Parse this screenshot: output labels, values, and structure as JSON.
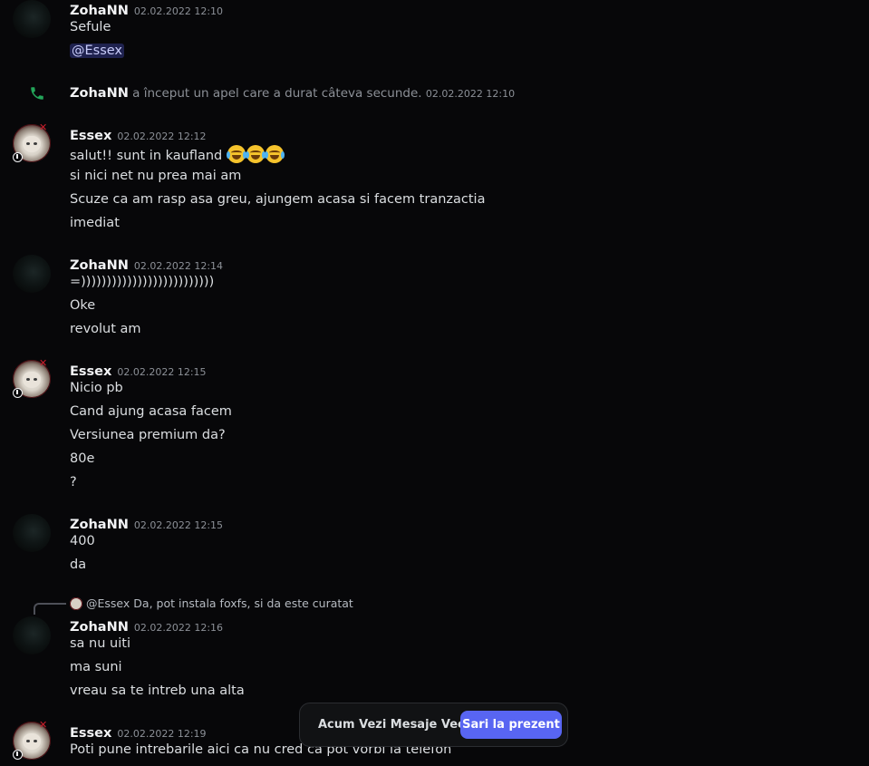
{
  "messages": {
    "g1": {
      "author": "ZohaNN",
      "time": "02.02.2022 12:10",
      "lines": [
        "Sefule",
        "@Essex"
      ]
    },
    "call": {
      "author": "ZohaNN",
      "text": "a început un apel care a durat câteva secunde.",
      "time": "02.02.2022 12:10"
    },
    "g2": {
      "author": "Essex",
      "time": "02.02.2022 12:12",
      "lines": [
        "salut!! sunt in kaufland",
        "si nici net nu prea mai am",
        "Scuze ca am rasp asa greu, ajungem acasa si facem tranzactia",
        "imediat"
      ]
    },
    "g3": {
      "author": "ZohaNN",
      "time": "02.02.2022 12:14",
      "lines": [
        "=))))))))))))))))))))))))))",
        "Oke",
        "revolut am"
      ]
    },
    "g4": {
      "author": "Essex",
      "time": "02.02.2022 12:15",
      "lines": [
        "Nicio pb",
        "Cand ajung acasa facem",
        "Versiunea premium da?",
        "80e",
        "?"
      ]
    },
    "g5": {
      "author": "ZohaNN",
      "time": "02.02.2022 12:15",
      "lines": [
        "400",
        "da"
      ]
    },
    "reply": {
      "author": "@Essex",
      "text": "Da, pot instala foxfs, si da este curatat"
    },
    "g6": {
      "author": "ZohaNN",
      "time": "02.02.2022 12:16",
      "lines": [
        "sa nu uiti",
        "ma suni",
        "vreau sa te intreb una alta"
      ]
    },
    "g7": {
      "author": "Essex",
      "time": "02.02.2022 12:19",
      "lines": [
        "Poti pune intrebarile aici ca nu cred ca pot vorbi la telefon"
      ]
    }
  },
  "jump_bar": {
    "label": "Acum Vezi Mesaje Vechi",
    "button": "Sari la prezent"
  },
  "icons": {
    "call": "phone-icon",
    "emoji": "joy-emoji-icon"
  },
  "colors": {
    "background": "#070709",
    "accent": "#5865f2",
    "call_green": "#23a55a",
    "mention_bg": "rgba(88,101,242,0.3)"
  }
}
